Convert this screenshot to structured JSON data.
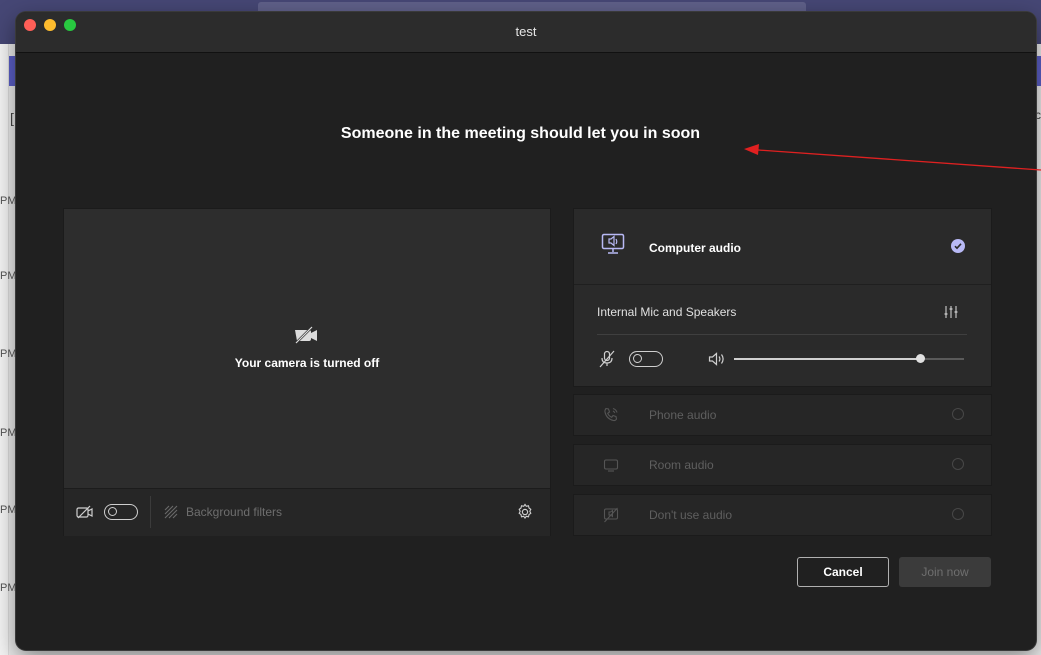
{
  "background_app": {
    "time_suffix": "PM",
    "right_partial_char": "c",
    "left_partial_char": "["
  },
  "window": {
    "title": "test"
  },
  "lobby_message": "Someone in the meeting should let you in soon",
  "video_panel": {
    "camera_status": "Your camera is turned off",
    "camera_toggle_on": false,
    "background_filters_label": "Background filters"
  },
  "audio_panel": {
    "selected_option": {
      "label": "Computer audio",
      "selected": true
    },
    "device_label": "Internal Mic and Speakers",
    "mic_toggle_on": false,
    "speaker_volume_fraction": 0.81,
    "other_options": [
      {
        "label": "Phone audio",
        "icon": "phone-icon"
      },
      {
        "label": "Room audio",
        "icon": "room-icon"
      },
      {
        "label": "Don't use audio",
        "icon": "no-audio-icon"
      }
    ]
  },
  "buttons": {
    "cancel": "Cancel",
    "join": "Join now"
  },
  "colors": {
    "window_bg": "#202020",
    "accent_purple": "#b8b9f5",
    "annotation_red": "#e02020",
    "teams_header": "#464775"
  }
}
